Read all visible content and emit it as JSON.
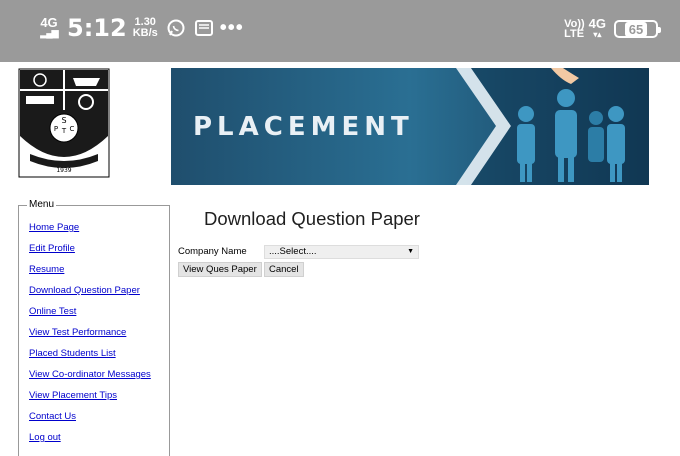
{
  "status_bar": {
    "network": "4G",
    "time": "5:12",
    "speed_value": "1.30",
    "speed_unit": "KB/s",
    "volte_top": "Vo))",
    "volte_bottom": "LTE",
    "net_type": "4G",
    "battery": "65",
    "icons": [
      "whatsapp-icon",
      "message-icon",
      "more-icon"
    ]
  },
  "logo": {
    "letters": [
      "S",
      "P",
      "T",
      "C"
    ],
    "year": "1939"
  },
  "banner": {
    "title": "PLACEMENT"
  },
  "menu": {
    "legend": "Menu",
    "items": [
      {
        "label": "Home Page"
      },
      {
        "label": "Edit Profile"
      },
      {
        "label": "Resume"
      },
      {
        "label": "Download Question Paper"
      },
      {
        "label": "Online Test"
      },
      {
        "label": "View Test Performance"
      },
      {
        "label": "Placed Students List"
      },
      {
        "label": "View Co-ordinator Messages"
      },
      {
        "label": "View Placement Tips"
      },
      {
        "label": "Contact Us"
      },
      {
        "label": "Log out"
      }
    ]
  },
  "main": {
    "heading": "Download Question Paper",
    "company_label": "Company Name",
    "company_select": "....Select....",
    "view_button": "View Ques Paper",
    "cancel_button": "Cancel"
  }
}
